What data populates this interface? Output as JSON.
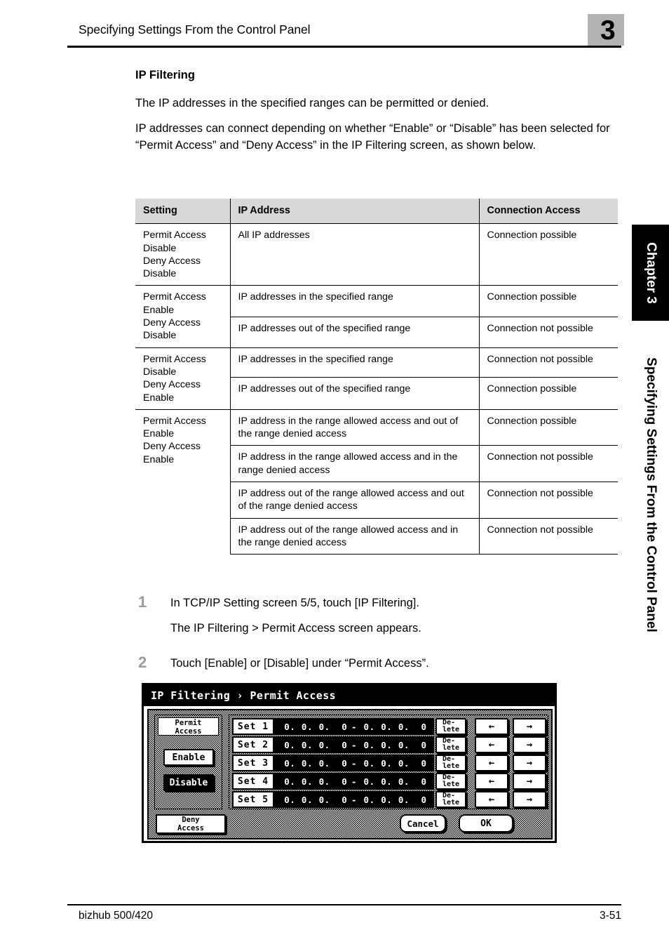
{
  "header": {
    "title": "Specifying Settings From the Control Panel",
    "chapter_number": "3"
  },
  "section": {
    "heading": "IP Filtering",
    "paragraph_1": "The IP addresses in the specified ranges can be permitted or denied.",
    "paragraph_2": "IP addresses can connect depending on whether “Enable” or “Disable” has been selected for “Permit Access” and “Deny Access” in the IP Filtering screen, as shown below."
  },
  "table": {
    "headers": [
      "Setting",
      "IP Address",
      "Connection Access"
    ],
    "groups": [
      {
        "setting": "Permit Access\nDisable\nDeny Access\nDisable",
        "rows": [
          {
            "ip": "All IP addresses",
            "access": "Connection possible"
          }
        ]
      },
      {
        "setting": "Permit Access\nEnable\nDeny Access\nDisable",
        "rows": [
          {
            "ip": "IP addresses in the specified range",
            "access": "Connection possible"
          },
          {
            "ip": "IP addresses out of the specified range",
            "access": "Connection not possible"
          }
        ]
      },
      {
        "setting": "Permit Access\nDisable\nDeny Access\nEnable",
        "rows": [
          {
            "ip": "IP addresses in the specified range",
            "access": "Connection not possible"
          },
          {
            "ip": "IP addresses out of the specified range",
            "access": "Connection possible"
          }
        ]
      },
      {
        "setting": "Permit Access\nEnable\nDeny Access\nEnable",
        "rows": [
          {
            "ip": "IP address in the range allowed access and out of the range denied access",
            "access": "Connection possible"
          },
          {
            "ip": "IP address in the range allowed access and in the range denied access",
            "access": "Connection not possible"
          },
          {
            "ip": "IP address out of the range allowed access and out of the range denied access",
            "access": "Connection not possible"
          },
          {
            "ip": "IP address out of the range allowed access and in the range denied access",
            "access": "Connection not possible"
          }
        ]
      }
    ]
  },
  "steps": [
    {
      "number": "1",
      "text": "In TCP/IP Setting screen 5/5, touch [IP Filtering].",
      "result": "The IP Filtering > Permit Access screen appears."
    },
    {
      "number": "2",
      "text": "Touch [Enable] or [Disable] under “Permit Access”."
    }
  ],
  "lcd": {
    "title": "IP Filtering › Permit Access",
    "permit_access_label": "Permit\nAccess",
    "enable_label": "Enable",
    "disable_label": "Disable",
    "deny_access_label": "Deny\nAccess",
    "delete_label": "De-\nlete",
    "arrow_left": "←",
    "arrow_right": "→",
    "cancel_label": "Cancel",
    "ok_label": "OK",
    "selected_permit": "Disable",
    "sets": [
      {
        "label": "Set 1",
        "start": [
          "0.",
          "0.",
          "0.",
          "0"
        ],
        "separator": "-",
        "end": [
          "0.",
          "0.",
          "0.",
          "0"
        ]
      },
      {
        "label": "Set 2",
        "start": [
          "0.",
          "0.",
          "0.",
          "0"
        ],
        "separator": "-",
        "end": [
          "0.",
          "0.",
          "0.",
          "0"
        ]
      },
      {
        "label": "Set 3",
        "start": [
          "0.",
          "0.",
          "0.",
          "0"
        ],
        "separator": "-",
        "end": [
          "0.",
          "0.",
          "0.",
          "0"
        ]
      },
      {
        "label": "Set 4",
        "start": [
          "0.",
          "0.",
          "0.",
          "0"
        ],
        "separator": "-",
        "end": [
          "0.",
          "0.",
          "0.",
          "0"
        ]
      },
      {
        "label": "Set 5",
        "start": [
          "0.",
          "0.",
          "0.",
          "0"
        ],
        "separator": "-",
        "end": [
          "0.",
          "0.",
          "0.",
          "0"
        ]
      }
    ]
  },
  "side_tab": {
    "chapter_label": "Chapter 3",
    "vertical_title": "Specifying Settings From the Control Panel"
  },
  "footer": {
    "model": "bizhub 500/420",
    "page_number": "3-51"
  }
}
